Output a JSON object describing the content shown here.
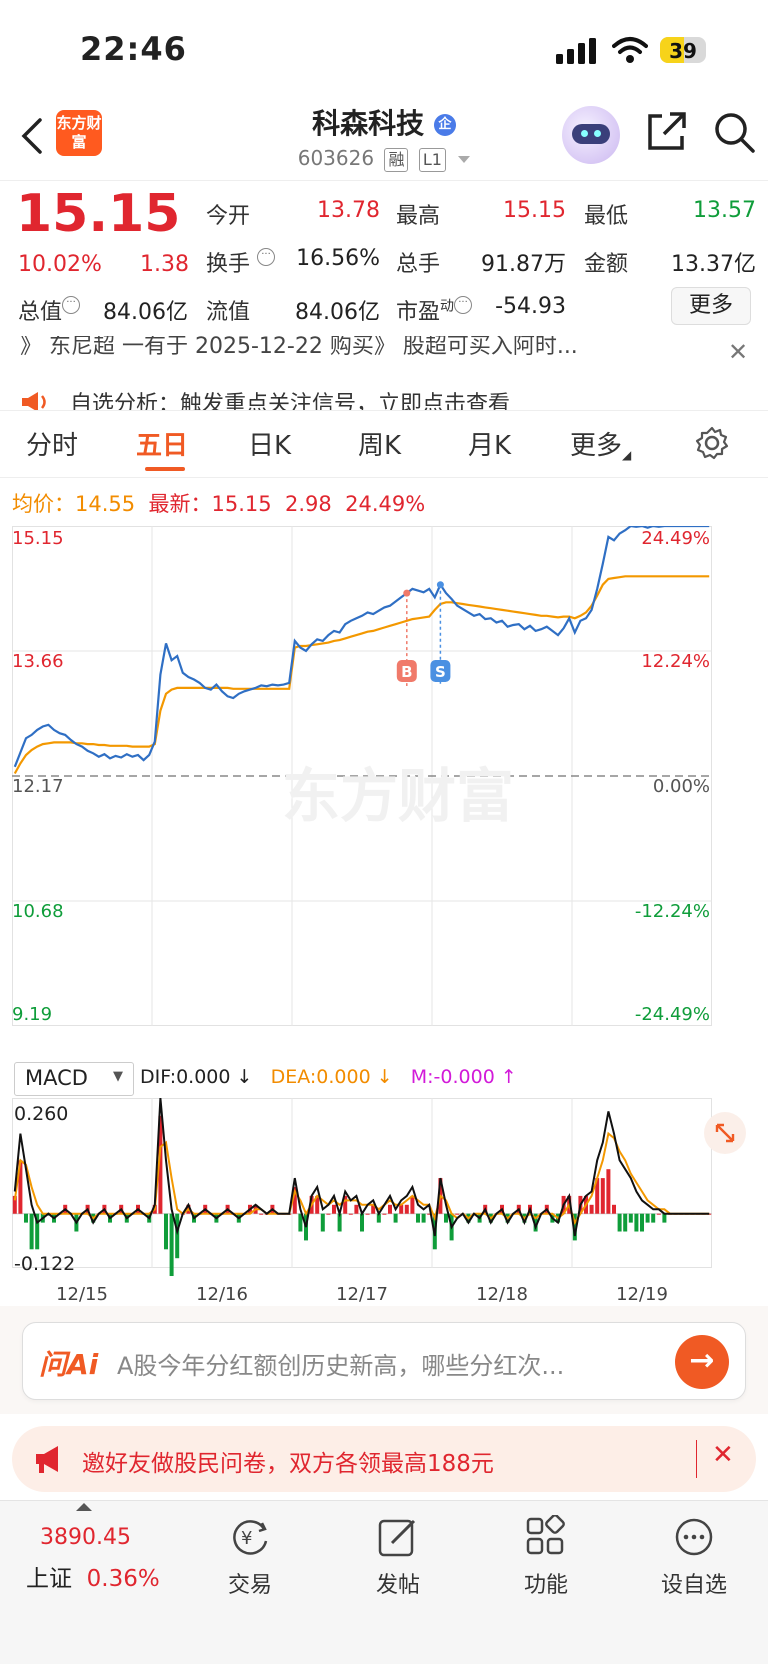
{
  "status_bar": {
    "time": "22:46",
    "battery": "39"
  },
  "header": {
    "logo_text": "东方财富",
    "stock_name": "科森科技",
    "stock_code": "603626",
    "tags": [
      "融",
      "L1"
    ]
  },
  "quote": {
    "price": "15.15",
    "change_pct": "10.02%",
    "change": "1.38",
    "items": {
      "open_label": "今开",
      "open": "13.78",
      "high_label": "最高",
      "high": "15.15",
      "low_label": "最低",
      "low": "13.57",
      "turnover_label": "换手",
      "turnover": "16.56%",
      "volume_label": "总手",
      "volume": "91.87万",
      "amount_label": "金额",
      "amount": "13.37亿",
      "mcap_label": "总值",
      "mcap": "84.06亿",
      "float_label": "流值",
      "float": "84.06亿",
      "pe_label": "市盈",
      "pe_sup": "动",
      "pe": "-54.93"
    },
    "more_label": "更多"
  },
  "notice": {
    "ticker_line": "》 东尼超 一有于 2025-12-22 购买》 股超可买入阿时...",
    "line2": "自选分析：触发重点关注信号，立即点击查看"
  },
  "tabs": [
    "分时",
    "五日",
    "日K",
    "周K",
    "月K",
    "更多"
  ],
  "active_tab": "五日",
  "indicators": {
    "avg_label": "均价：",
    "avg": "14.55",
    "latest_label": "最新：",
    "latest": "15.15",
    "chg": "2.98",
    "chg_pct": "24.49%"
  },
  "chart_data": {
    "type": "line",
    "title": "",
    "x_labels": [
      "12/15",
      "12/16",
      "12/17",
      "12/18",
      "12/19"
    ],
    "y_left_ticks": [
      "15.15",
      "13.66",
      "12.17",
      "10.68",
      "9.19"
    ],
    "y_right_ticks": [
      "24.49%",
      "12.24%",
      "0.00%",
      "-12.24%",
      "-24.49%"
    ],
    "ylim": [
      9.19,
      15.15
    ],
    "base_price": 12.17,
    "watermark": "东方财富",
    "series": [
      {
        "name": "price",
        "values": [
          12.28,
          12.45,
          12.62,
          12.66,
          12.72,
          12.76,
          12.78,
          12.72,
          12.68,
          12.66,
          12.6,
          12.55,
          12.52,
          12.47,
          12.44,
          12.4,
          12.43,
          12.38,
          12.41,
          12.39,
          12.43,
          12.4,
          12.42,
          12.36,
          12.42,
          12.58,
          13.38,
          13.75,
          13.55,
          13.6,
          13.4,
          13.35,
          13.32,
          13.28,
          13.22,
          13.2,
          13.26,
          13.18,
          13.12,
          13.1,
          13.15,
          13.18,
          13.2,
          13.22,
          13.25,
          13.24,
          13.26,
          13.25,
          13.26,
          13.28,
          13.78,
          13.7,
          13.66,
          13.74,
          13.8,
          13.78,
          13.85,
          13.9,
          13.88,
          13.98,
          14.02,
          14.05,
          14.08,
          14.12,
          14.1,
          14.14,
          14.18,
          14.2,
          14.25,
          14.3,
          14.35,
          14.4,
          14.38,
          14.36,
          14.4,
          14.3,
          14.45,
          14.35,
          14.28,
          14.2,
          14.16,
          14.12,
          14.08,
          14.1,
          14.04,
          14.05,
          14.0,
          14.02,
          13.95,
          13.97,
          13.98,
          13.92,
          13.96,
          13.9,
          13.92,
          13.95,
          13.9,
          13.85,
          13.93,
          14.05,
          13.88,
          14.02,
          14.05,
          14.15,
          14.4,
          14.7,
          15.02,
          14.98,
          15.06,
          15.1,
          15.15,
          15.14,
          15.15,
          15.13,
          15.15,
          15.14,
          15.15,
          15.15,
          15.15,
          15.15,
          15.15,
          15.15,
          15.15,
          15.15,
          15.15
        ]
      },
      {
        "name": "avg",
        "values": [
          12.2,
          12.32,
          12.42,
          12.48,
          12.52,
          12.55,
          12.56,
          12.57,
          12.57,
          12.57,
          12.57,
          12.56,
          12.56,
          12.55,
          12.55,
          12.54,
          12.54,
          12.53,
          12.53,
          12.53,
          12.53,
          12.52,
          12.52,
          12.52,
          12.52,
          12.55,
          12.95,
          13.15,
          13.2,
          13.22,
          13.22,
          13.22,
          13.22,
          13.22,
          13.22,
          13.22,
          13.22,
          13.22,
          13.22,
          13.21,
          13.21,
          13.21,
          13.21,
          13.21,
          13.21,
          13.21,
          13.21,
          13.21,
          13.21,
          13.21,
          13.7,
          13.72,
          13.72,
          13.73,
          13.74,
          13.75,
          13.76,
          13.78,
          13.79,
          13.81,
          13.83,
          13.85,
          13.87,
          13.89,
          13.9,
          13.92,
          13.94,
          13.96,
          13.98,
          14.0,
          14.02,
          14.04,
          14.05,
          14.06,
          14.07,
          14.15,
          14.22,
          14.24,
          14.24,
          14.23,
          14.22,
          14.21,
          14.2,
          14.19,
          14.18,
          14.17,
          14.16,
          14.15,
          14.14,
          14.13,
          14.12,
          14.11,
          14.1,
          14.09,
          14.08,
          14.08,
          14.07,
          14.06,
          14.07,
          14.07,
          14.05,
          14.08,
          14.12,
          14.2,
          14.32,
          14.45,
          14.52,
          14.53,
          14.54,
          14.55,
          14.55,
          14.55,
          14.55,
          14.55,
          14.55,
          14.55,
          14.55,
          14.55,
          14.55,
          14.55,
          14.55,
          14.55,
          14.55,
          14.55,
          14.55
        ]
      }
    ],
    "trade_marks": [
      {
        "label": "B",
        "index": 70,
        "color": "#f07a6a"
      },
      {
        "label": "S",
        "index": 76,
        "color": "#4a90e2"
      }
    ]
  },
  "macd": {
    "selector": "MACD",
    "dif": "DIF:0.000 ↓",
    "dea": "DEA:0.000 ↓",
    "m": "M:-0.000 ↑",
    "y_top": "0.260",
    "y_bottom": "-0.122",
    "ylim": [
      -0.122,
      0.26
    ],
    "dif_values": [
      0.05,
      0.18,
      0.1,
      0.02,
      -0.02,
      -0.01,
      0.0,
      -0.01,
      0.0,
      0.01,
      0.0,
      -0.02,
      0.0,
      0.01,
      -0.02,
      0.0,
      0.01,
      -0.01,
      0.0,
      0.01,
      -0.01,
      0.0,
      0.01,
      0.0,
      -0.01,
      0.02,
      0.26,
      0.12,
      0.01,
      -0.04,
      0.0,
      0.02,
      -0.01,
      0.0,
      0.01,
      0.0,
      -0.01,
      0.0,
      0.01,
      0.0,
      -0.01,
      0.0,
      0.01,
      0.02,
      0.01,
      0.0,
      0.01,
      0.0,
      0.0,
      0.0,
      0.08,
      0.01,
      -0.03,
      0.04,
      0.06,
      0.01,
      0.02,
      0.04,
      0.0,
      0.05,
      0.03,
      0.04,
      0.0,
      0.02,
      0.03,
      0.0,
      0.02,
      0.04,
      0.01,
      0.03,
      0.04,
      0.06,
      0.02,
      0.01,
      0.02,
      -0.05,
      0.08,
      0.02,
      -0.03,
      -0.01,
      0.0,
      -0.02,
      0.0,
      -0.01,
      0.01,
      -0.02,
      0.0,
      0.01,
      -0.02,
      0.0,
      0.01,
      -0.02,
      0.01,
      -0.03,
      0.0,
      0.01,
      -0.01,
      -0.02,
      0.02,
      0.04,
      -0.05,
      0.02,
      0.04,
      0.05,
      0.12,
      0.16,
      0.23,
      0.18,
      0.12,
      0.1,
      0.08,
      0.05,
      0.03,
      0.02,
      0.01,
      0.01,
      0.0,
      0.0,
      0.0,
      0.0,
      0.0,
      0.0,
      0.0,
      0.0,
      0.0
    ],
    "dea_values": [
      0.03,
      0.12,
      0.11,
      0.06,
      0.02,
      0.0,
      0.0,
      0.0,
      0.0,
      0.0,
      0.0,
      0.0,
      0.0,
      0.0,
      -0.01,
      0.0,
      0.0,
      0.0,
      0.0,
      0.0,
      0.0,
      0.0,
      0.0,
      0.0,
      0.0,
      0.01,
      0.15,
      0.16,
      0.08,
      0.01,
      0.0,
      0.01,
      0.0,
      0.0,
      0.0,
      0.0,
      0.0,
      0.0,
      0.0,
      0.0,
      0.0,
      0.0,
      0.0,
      0.01,
      0.01,
      0.0,
      0.0,
      0.0,
      0.0,
      0.0,
      0.05,
      0.03,
      0.0,
      0.02,
      0.04,
      0.03,
      0.02,
      0.03,
      0.02,
      0.03,
      0.03,
      0.03,
      0.02,
      0.02,
      0.02,
      0.01,
      0.02,
      0.03,
      0.02,
      0.02,
      0.03,
      0.04,
      0.03,
      0.02,
      0.02,
      -0.01,
      0.04,
      0.03,
      0.0,
      -0.01,
      0.0,
      -0.01,
      0.0,
      0.0,
      0.0,
      -0.01,
      0.0,
      0.0,
      -0.01,
      0.0,
      0.0,
      -0.01,
      0.0,
      -0.01,
      0.0,
      0.0,
      0.0,
      -0.01,
      0.0,
      0.02,
      -0.02,
      0.0,
      0.02,
      0.04,
      0.08,
      0.12,
      0.18,
      0.17,
      0.14,
      0.12,
      0.09,
      0.07,
      0.05,
      0.03,
      0.02,
      0.01,
      0.01,
      0.0,
      0.0,
      0.0,
      0.0,
      0.0,
      0.0,
      0.0,
      0.0
    ]
  },
  "ask_bar": {
    "brand": "问Ai",
    "question": "A股今年分红额创历史新高，哪些分红次...",
    "go": "→"
  },
  "promo": {
    "text": "邀好友做股民问卷，双方各领最高188元",
    "close": "✕"
  },
  "bottom_nav": {
    "index_value": "3890.45",
    "index_name": "上证",
    "index_pct": "0.36%",
    "items": [
      "交易",
      "发帖",
      "功能",
      "设自选"
    ]
  },
  "colors": {
    "accent": "#f05a24",
    "up": "#e0262f",
    "down": "#0f9d3a",
    "price_line": "#2f6fc4",
    "avg_line": "#f39800"
  }
}
